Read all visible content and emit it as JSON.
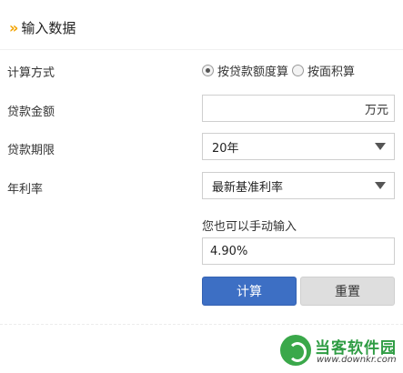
{
  "header": {
    "chevron": "»",
    "title": "输入数据"
  },
  "form": {
    "method_label": "计算方式",
    "method_options": [
      {
        "label": "按贷款额度算",
        "checked": true
      },
      {
        "label": "按面积算",
        "checked": false
      }
    ],
    "amount_label": "贷款金额",
    "amount_value": "",
    "amount_unit": "万元",
    "term_label": "贷款期限",
    "term_value": "20年",
    "rate_label": "年利率",
    "rate_select_value": "最新基准利率",
    "rate_hint": "您也可以手动输入",
    "rate_input_value": "4.90%"
  },
  "buttons": {
    "calculate": "计算",
    "reset": "重置"
  },
  "watermark": {
    "name": "当客软件园",
    "url": "www.downkr.com"
  },
  "colors": {
    "accent": "#f2a300",
    "primary_button": "#3d6fc4",
    "secondary_button": "#dedede",
    "watermark_green": "#2e9c43"
  }
}
